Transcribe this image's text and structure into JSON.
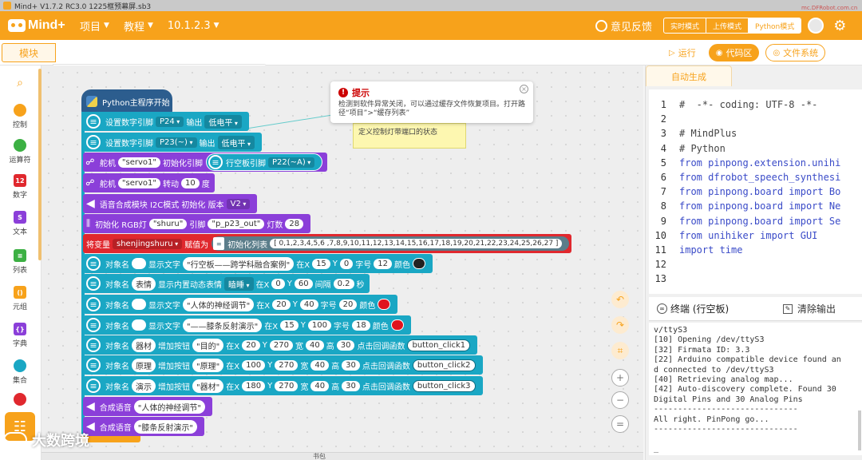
{
  "window": {
    "title": "Mind+ V1.7.2 RC3.0    1225框预幕屏.sb3",
    "watermark": "mc.DFRobot.com.cn"
  },
  "toolbar": {
    "logo_text": "Mind+",
    "menus": [
      "项目",
      "教程",
      "10.1.2.3"
    ],
    "feedback": "意见反馈",
    "modes": [
      "实时模式",
      "上传模式",
      "Python模式"
    ],
    "active_mode": "Python模式",
    "accent": "#f7a21b"
  },
  "tabs": {
    "blocks": "模块",
    "code": "代码"
  },
  "run_buttons": {
    "run": "运行",
    "code_area": "代码区",
    "file_system": "文件系统"
  },
  "categories": [
    {
      "label": "控制",
      "color": "#f7a21b"
    },
    {
      "label": "运算符",
      "color": "#3cb043"
    },
    {
      "label": "数字",
      "color": "#e0282e"
    },
    {
      "label": "文本",
      "color": "#8b3fd9"
    },
    {
      "label": "列表",
      "color": "#3cb043"
    },
    {
      "label": "元组",
      "color": "#f7a21b"
    },
    {
      "label": "字典",
      "color": "#8b3fd9"
    },
    {
      "label": "集合",
      "color": "#1aa7c4"
    },
    {
      "label": "",
      "color": "#e0282e"
    }
  ],
  "tooltip": {
    "title": "提示",
    "body": "检测到软件异常关闭，可以通过缓存文件恢复项目。打开路径“项目”>“缓存列表”"
  },
  "note": "定义控制灯带端口的状态",
  "blocks": {
    "hat": "Python主程序开始",
    "b1": {
      "a": "设置数字引脚",
      "pin": "P24",
      "b": "输出",
      "level": "低电平"
    },
    "b2": {
      "a": "设置数字引脚",
      "pin": "P23(~)",
      "b": "输出",
      "level": "低电平"
    },
    "b3": {
      "a": "舵机",
      "name": "\"servo1\"",
      "b": "初始化引脚",
      "inner": "行空板引脚",
      "pin": "P22(~A)"
    },
    "b4": {
      "a": "舵机",
      "name": "\"servo1\"",
      "b": "转动",
      "val": "10",
      "c": "度"
    },
    "b5": {
      "a": "语音合成模块 I2C模式 初始化 版本",
      "ver": "V2"
    },
    "b6": {
      "a": "初始化 RGB灯",
      "name": "\"shuru\"",
      "b": "引脚",
      "pin": "\"p_p23_out\"",
      "c": "灯数",
      "num": "28"
    },
    "b7": {
      "a": "将变量",
      "var": "shenjingshuru",
      "b": "赋值为",
      "inner": "初始化列表",
      "list": "[ 0,1,2,3,4,5,6 ,7,8,9,10,11,12,13,14,15,16,17,18,19,20,21,22,23,24,25,26,27 ]"
    },
    "b8": {
      "a": "对象名",
      "b": "显示文字",
      "text": "\"行空板——跨学科融合案例\"",
      "xl": "在X",
      "x": "15",
      "yl": "Y",
      "y": "0",
      "sl": "字号",
      "s": "12",
      "cl": "颜色",
      "color": "#222222"
    },
    "b9": {
      "a": "对象名",
      "obj": "表情",
      "b": "显示内置动态表情",
      "emo": "瞌睡",
      "xl": "在X",
      "x": "0",
      "yl": "Y",
      "y": "60",
      "il": "间隔",
      "i": "0.2",
      "u": "秒"
    },
    "b10": {
      "a": "对象名",
      "b": "显示文字",
      "text": "\"人体的神经调节\"",
      "xl": "在X",
      "x": "20",
      "yl": "Y",
      "y": "40",
      "sl": "字号",
      "s": "20",
      "cl": "颜色",
      "color": "#e0141e"
    },
    "b11": {
      "a": "对象名",
      "b": "显示文字",
      "text": "\"——膝条反射演示\"",
      "xl": "在X",
      "x": "15",
      "yl": "Y",
      "y": "100",
      "sl": "字号",
      "s": "18",
      "cl": "颜色",
      "color": "#e0141e"
    },
    "b12": {
      "a": "对象名",
      "obj": "器材",
      "b": "增加按钮",
      "text": "\"目的\"",
      "xl": "在X",
      "x": "20",
      "yl": "Y",
      "y": "270",
      "wl": "宽",
      "w": "40",
      "hl": "高",
      "h": "30",
      "cbl": "点击回调函数",
      "cb": "button_click1"
    },
    "b13": {
      "a": "对象名",
      "obj": "原理",
      "b": "增加按钮",
      "text": "\"原理\"",
      "xl": "在X",
      "x": "100",
      "yl": "Y",
      "y": "270",
      "wl": "宽",
      "w": "40",
      "hl": "高",
      "h": "30",
      "cbl": "点击回调函数",
      "cb": "button_click2"
    },
    "b14": {
      "a": "对象名",
      "obj": "演示",
      "b": "增加按钮",
      "text": "\"器材\"",
      "xl": "在X",
      "x": "180",
      "yl": "Y",
      "y": "270",
      "wl": "宽",
      "w": "40",
      "hl": "高",
      "h": "30",
      "cbl": "点击回调函数",
      "cb": "button_click3"
    },
    "b15": {
      "a": "合成语音",
      "text": "\"人体的神经调节\""
    },
    "b16": {
      "a": "合成语音",
      "text": "\"膝条反射演示\""
    }
  },
  "code_panel": {
    "tab": "自动生成",
    "lines": [
      {
        "n": "1",
        "t": "#  -*- coding: UTF-8 -*-"
      },
      {
        "n": "2",
        "t": ""
      },
      {
        "n": "3",
        "t": "# MindPlus"
      },
      {
        "n": "4",
        "t": "# Python"
      },
      {
        "n": "5",
        "t": "from pinpong.extension.unihi"
      },
      {
        "n": "6",
        "t": "from dfrobot_speech_synthesi"
      },
      {
        "n": "7",
        "t": "from pinpong.board import Bo"
      },
      {
        "n": "8",
        "t": "from pinpong.board import Ne"
      },
      {
        "n": "9",
        "t": "from pinpong.board import Se"
      },
      {
        "n": "10",
        "t": "from unihiker import GUI"
      },
      {
        "n": "11",
        "t": "import time"
      },
      {
        "n": "12",
        "t": ""
      },
      {
        "n": "13",
        "t": ""
      }
    ]
  },
  "terminal": {
    "title": "终端 (行空板)",
    "clear": "清除输出",
    "lines": [
      "v/ttyS3",
      "[10] Opening /dev/ttyS3",
      "[32] Firmata ID: 3.3",
      "[22] Arduino compatible device found an",
      "d connected to /dev/ttyS3",
      "[40] Retrieving analog map...",
      "[42] Auto-discovery complete. Found 30",
      "Digital Pins and 30 Analog Pins",
      "------------------------------",
      "All right. PinPong go...",
      "------------------------------",
      "",
      "_"
    ]
  },
  "workspace_footer": "书包",
  "watermark_bottom": "大数跨境"
}
